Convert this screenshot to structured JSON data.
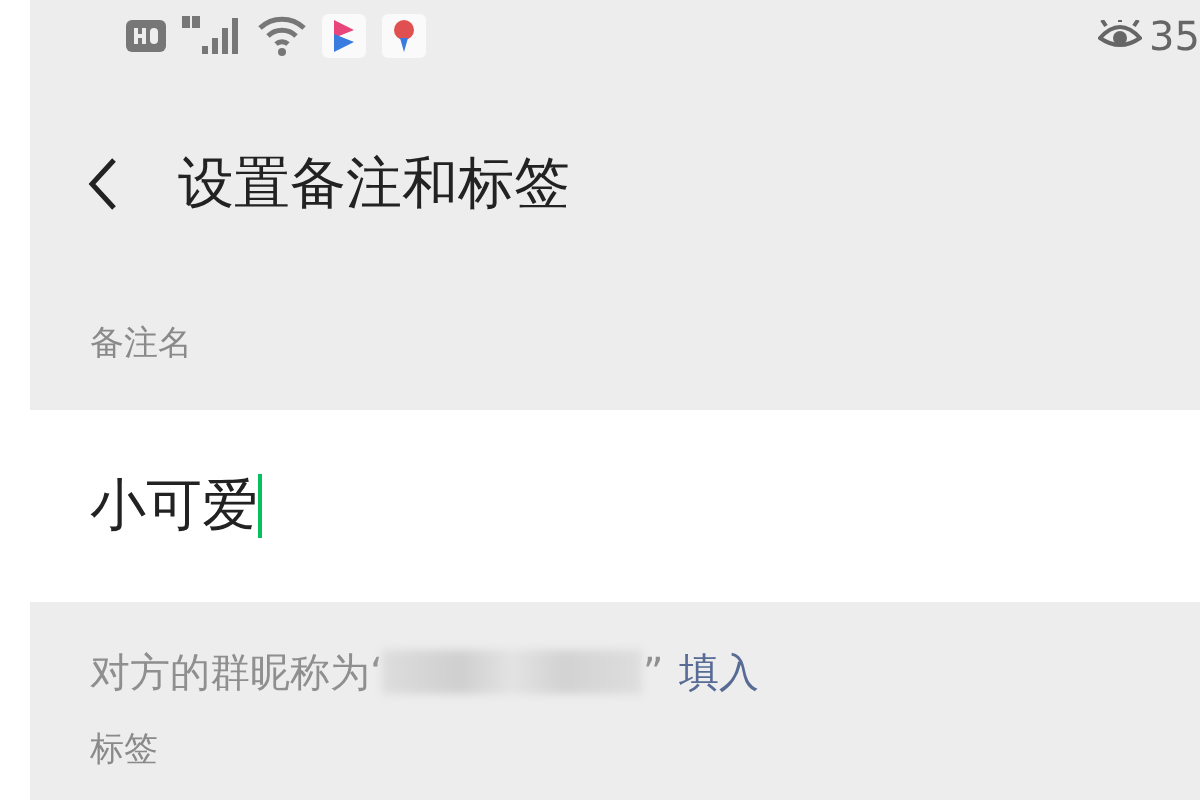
{
  "status_bar": {
    "right_text": "35"
  },
  "header": {
    "title": "设置备注和标签"
  },
  "remark": {
    "label": "备注名",
    "value": "小可爱",
    "focused": true
  },
  "hint": {
    "prefix": "对方的群昵称为‘",
    "suffix": "”",
    "link": "填入"
  },
  "tags": {
    "label": "标签"
  }
}
